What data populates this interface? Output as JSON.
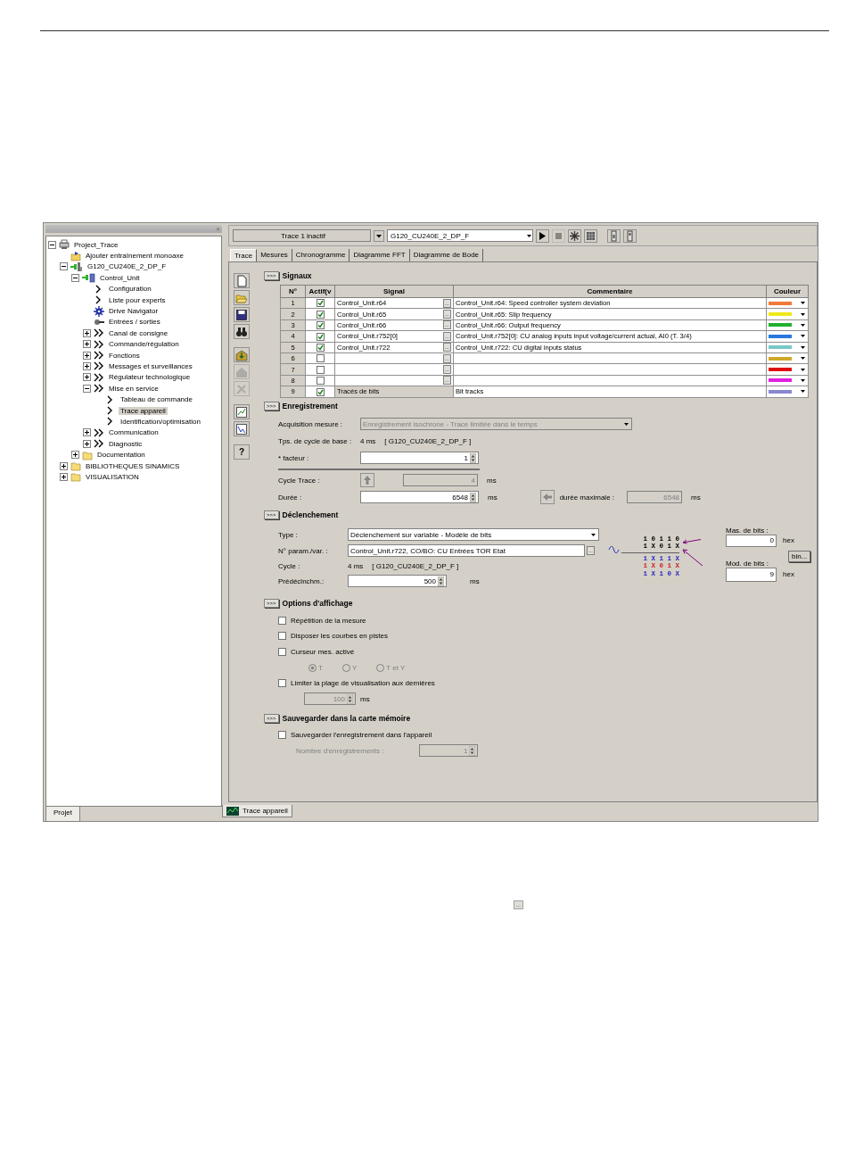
{
  "app": {
    "project_panel": {
      "close": "×",
      "tab": {
        "label": "Projet",
        "selected": true
      },
      "tree": [
        {
          "label": "Project_Trace",
          "kind": "project",
          "expanded": true,
          "selected": false,
          "children": [
            {
              "label": "Ajouter entraînement monoaxe",
              "kind": "add",
              "selected": false
            },
            {
              "label": "G120_CU240E_2_DP_F",
              "kind": "device",
              "expanded": true,
              "selected": false,
              "children": [
                {
                  "label": "Control_Unit",
                  "kind": "unit",
                  "expanded": true,
                  "selected": false,
                  "children": [
                    {
                      "label": "Configuration",
                      "kind": "single",
                      "selected": false
                    },
                    {
                      "label": "Liste pour experts",
                      "kind": "single",
                      "selected": false
                    },
                    {
                      "label": "Drive Navigator",
                      "kind": "navigator",
                      "selected": false
                    },
                    {
                      "label": "Entrées / sorties",
                      "kind": "io",
                      "selected": false
                    },
                    {
                      "label": "Canal de consigne",
                      "kind": "double",
                      "expanded": false,
                      "selected": false
                    },
                    {
                      "label": "Commande/régulation",
                      "kind": "double",
                      "expanded": false,
                      "selected": false
                    },
                    {
                      "label": "Fonctions",
                      "kind": "double",
                      "expanded": false,
                      "selected": false
                    },
                    {
                      "label": "Messages et surveillances",
                      "kind": "double",
                      "expanded": false,
                      "selected": false
                    },
                    {
                      "label": "Régulateur technologique",
                      "kind": "double",
                      "expanded": false,
                      "selected": false
                    },
                    {
                      "label": "Mise en service",
                      "kind": "double",
                      "expanded": true,
                      "selected": false,
                      "children": [
                        {
                          "label": "Tableau de commande",
                          "kind": "single",
                          "selected": false
                        },
                        {
                          "label": "Trace appareil",
                          "kind": "single",
                          "selected": true
                        },
                        {
                          "label": "Identification/optimisation",
                          "kind": "single",
                          "selected": false
                        }
                      ]
                    },
                    {
                      "label": "Communication",
                      "kind": "double",
                      "expanded": false,
                      "selected": false
                    },
                    {
                      "label": "Diagnostic",
                      "kind": "double",
                      "expanded": false,
                      "selected": false
                    }
                  ]
                },
                {
                  "label": "Documentation",
                  "kind": "folder",
                  "expanded": false,
                  "selected": false
                }
              ]
            },
            {
              "label": "BIBLIOTHEQUES SINAMICS",
              "kind": "folder",
              "expanded": false,
              "selected": false
            },
            {
              "label": "VISUALISATION",
              "kind": "folder",
              "expanded": false,
              "selected": false
            }
          ]
        }
      ]
    },
    "toolbar": {
      "trace_select": {
        "value": "Trace 1 inactif"
      },
      "device_select": {
        "value": "G120_CU240E_2_DP_F"
      },
      "buttons": [
        {
          "kind": "play",
          "disabled": false
        },
        {
          "kind": "stop",
          "disabled": true
        },
        {
          "kind": "trigger",
          "disabled": false
        },
        {
          "kind": "record",
          "disabled": false
        },
        {
          "kind": "upload",
          "disabled": false
        },
        {
          "kind": "download",
          "disabled": false
        }
      ]
    },
    "tabs": [
      {
        "label": "Trace",
        "selected": true
      },
      {
        "label": "Mesures",
        "selected": false
      },
      {
        "label": "Chronogramme",
        "selected": false
      },
      {
        "label": "Diagramme FFT",
        "selected": false
      },
      {
        "label": "Diagramme de Bode",
        "selected": false
      }
    ],
    "side_tools": [
      [
        {
          "kind": "new",
          "disabled": false
        },
        {
          "kind": "open",
          "disabled": false
        },
        {
          "kind": "save",
          "disabled": false
        },
        {
          "kind": "find",
          "disabled": false
        }
      ],
      [
        {
          "kind": "import",
          "disabled": false
        },
        {
          "kind": "home",
          "disabled": true
        },
        {
          "kind": "tool",
          "disabled": true
        }
      ],
      [
        {
          "kind": "chart",
          "disabled": false
        },
        {
          "kind": "chart2",
          "disabled": false
        }
      ],
      [
        {
          "kind": "help",
          "label": "?",
          "disabled": false
        }
      ]
    ],
    "signals": {
      "title": "Signaux",
      "toggle": ">>>",
      "columns": [
        "N°",
        "Actif(v",
        "Signal",
        "Commentaire",
        "Couleur"
      ],
      "browse": "...",
      "rows": [
        {
          "kind": "signal",
          "n": "1",
          "active": true,
          "signal": "Control_Unit.r64",
          "comment": "Control_Unit.r64: Speed controller system deviation",
          "color": "#f07838"
        },
        {
          "kind": "signal",
          "n": "2",
          "active": true,
          "signal": "Control_Unit.r65",
          "comment": "Control_Unit.r65: Slip frequency",
          "color": "#f0e818"
        },
        {
          "kind": "signal",
          "n": "3",
          "active": true,
          "signal": "Control_Unit.r66",
          "comment": "Control_Unit.r66: Output frequency",
          "color": "#20b030"
        },
        {
          "kind": "signal",
          "n": "4",
          "active": true,
          "signal": "Control_Unit.r752[0]",
          "comment": "Control_Unit.r752[0]: CU analog inputs input voltage/current actual, AI0 (T. 3/4)",
          "color": "#2878e0"
        },
        {
          "kind": "signal",
          "n": "5",
          "active": true,
          "signal": "Control_Unit.r722",
          "comment": "Control_Unit.r722: CU digital inputs status",
          "color": "#78c8c8"
        },
        {
          "kind": "signal",
          "n": "6",
          "active": false,
          "color": "#d0a828"
        },
        {
          "kind": "signal",
          "n": "7",
          "active": false,
          "color": "#e01010"
        },
        {
          "kind": "signal",
          "n": "8",
          "active": false,
          "color": "#e020e0"
        },
        {
          "kind": "bits",
          "n": "9",
          "active": true,
          "signal": "Tracés de bits",
          "comment": "Bit tracks",
          "color": "#8888d0"
        }
      ]
    },
    "recording": {
      "title": "Enregistrement",
      "toggle": ">>>",
      "acquisition": {
        "label": "Acquisition mesure :",
        "value": "Enregistrement isochrone - Trace limitée dans le temps",
        "disabled": true
      },
      "base_cycle": {
        "label": "Tps. de cycle de base :",
        "value": "4 ms",
        "device": "[ G120_CU240E_2_DP_F ]"
      },
      "factor": {
        "label": "* facteur :",
        "value": "1"
      },
      "trace_cycle": {
        "label": "Cycle Trace :",
        "value": "4",
        "unit": "ms",
        "disabled": true
      },
      "duration": {
        "label": "Durée :",
        "value": "6548",
        "unit": "ms"
      },
      "max_duration": {
        "label": "durée maximale :",
        "value": "6548",
        "unit": "ms",
        "disabled": true
      }
    },
    "trigger": {
      "title": "Déclenchement",
      "toggle": ">>>",
      "type": {
        "label": "Type :",
        "value": "Déclenchement sur variable - Modèle de bits"
      },
      "param": {
        "label": "N° param./var. :",
        "value": "Control_Unit.r722, CO/BO: CU Entrées TOR Etat",
        "button": "..."
      },
      "cycle": {
        "label": "Cycle :",
        "value": "4 ms",
        "device": "[ G120_CU240E_2_DP_F ]"
      },
      "pretrigger": {
        "label": "Prédéclnchm.:",
        "value": "500",
        "unit": "ms"
      },
      "bit_pattern": {
        "mask_row": "1 0 1 1 0",
        "pattern_row": "1 X 0 1 X",
        "examples": [
          {
            "text": "1 X 1 1 X",
            "color": "#2828c0"
          },
          {
            "text": "1 X 0 1 X",
            "color": "#d02020"
          },
          {
            "text": "1 X 1 0 X",
            "color": "#2828c0"
          }
        ]
      },
      "mask": {
        "label": "Mas. de bits :",
        "value": "0",
        "unit": "hex"
      },
      "bin_button": "bin...",
      "model": {
        "label": "Mod. de bits :",
        "value": "9",
        "unit": "hex"
      }
    },
    "display_options": {
      "title": "Options d'affichage",
      "toggle": ">>>",
      "options": [
        {
          "kind": "checkbox",
          "label": "Répétition de la mesure",
          "checked": false
        },
        {
          "kind": "checkbox",
          "label": "Disposer les courbes en pistes",
          "checked": false
        },
        {
          "kind": "checkbox",
          "label": "Curseur mes. activé",
          "checked": false
        },
        {
          "kind": "radios",
          "disabled": true,
          "choices": [
            {
              "label": "T",
              "selected": true
            },
            {
              "label": "Y",
              "selected": false
            },
            {
              "label": "T et Y",
              "selected": false
            }
          ]
        },
        {
          "kind": "checkbox",
          "label": "Limiter la plage de visualisation aux dernières",
          "checked": false
        },
        {
          "kind": "spin",
          "value": "100",
          "unit": "ms",
          "disabled": true
        }
      ]
    },
    "save_to_card": {
      "title": "Sauvegarder dans la carte mémoire",
      "toggle": ">>>",
      "option": {
        "label": "Sauvegarder l'enregistrement dans l'appareil",
        "checked": false
      },
      "count": {
        "label": "Nombre d'enregistrements :",
        "value": "1",
        "disabled": true
      }
    },
    "document_tab": {
      "label": "Trace appareil",
      "selected": true
    }
  },
  "inline_button": {
    "label": "..."
  }
}
